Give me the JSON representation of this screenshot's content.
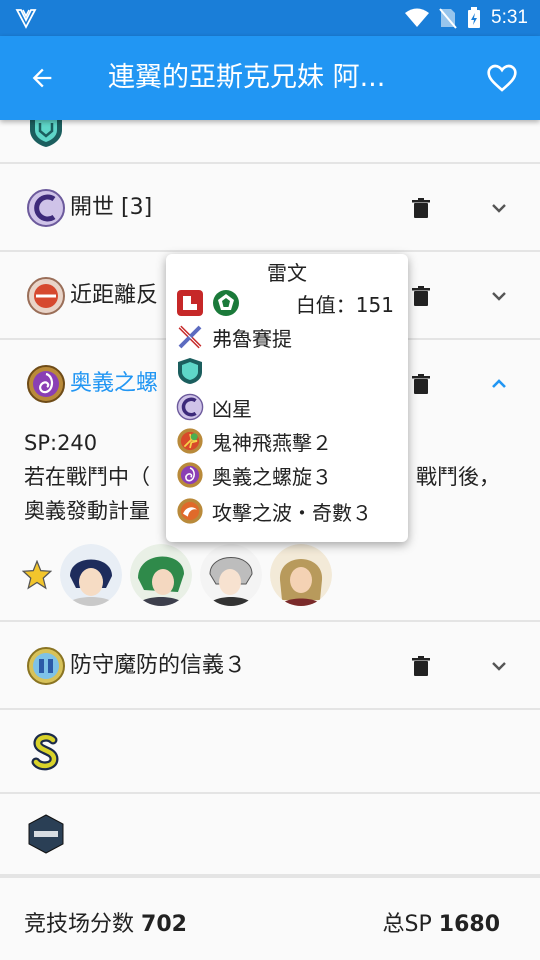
{
  "status": {
    "time": "5:31"
  },
  "appbar": {
    "title": "連翼的亞斯克兄妹  阿..."
  },
  "skills": {
    "kaisei": "開世 [3]",
    "kinkyori": "近距離反",
    "ougi": "奥義之螺",
    "bougyo": "防守魔防的信義３"
  },
  "desc": {
    "sp": "SP:240",
    "line1": "若在戰鬥中（",
    "line1_tail": "戰鬥後，",
    "line2": "奧義發動計量"
  },
  "popup": {
    "name": "雷文",
    "white_value": "白值：151",
    "weapon": "弗魯賽提",
    "seal": "凶星",
    "special": "鬼神飛燕擊２",
    "ougi": "奥義之螺旋３",
    "wave": "攻擊之波・奇數３"
  },
  "footer": {
    "arena_label": "竞技场分数",
    "arena_value": "702",
    "sp_label": "总SP",
    "sp_value": "1680"
  },
  "colors": {
    "appbar": "#2196f3",
    "statusbar": "#1a7ed8",
    "accent": "#2196f3"
  }
}
